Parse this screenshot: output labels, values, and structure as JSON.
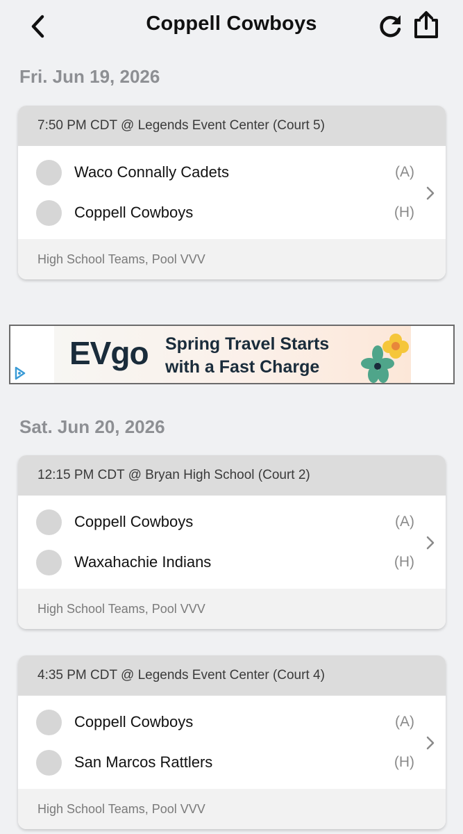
{
  "header": {
    "title": "Coppell Cowboys",
    "back_icon": "chevron-left-icon",
    "refresh_icon": "refresh-icon",
    "share_icon": "share-icon"
  },
  "days": [
    {
      "date": "Fri. Jun 19, 2026",
      "games": [
        {
          "time_location": "7:50 PM CDT @ Legends Event Center (Court 5)",
          "teams": [
            {
              "name": "Waco Connally Cadets",
              "side": "(A)"
            },
            {
              "name": "Coppell Cowboys",
              "side": "(H)"
            }
          ],
          "division": "High School Teams, Pool VVV"
        }
      ]
    },
    {
      "date": "Sat. Jun 20, 2026",
      "games": [
        {
          "time_location": "12:15 PM CDT @ Bryan High School (Court 2)",
          "teams": [
            {
              "name": "Coppell Cowboys",
              "side": "(A)"
            },
            {
              "name": "Waxahachie Indians",
              "side": "(H)"
            }
          ],
          "division": "High School Teams, Pool VVV"
        },
        {
          "time_location": "4:35 PM CDT @ Legends Event Center (Court 4)",
          "teams": [
            {
              "name": "Coppell Cowboys",
              "side": "(A)"
            },
            {
              "name": "San Marcos Rattlers",
              "side": "(H)"
            }
          ],
          "division": "High School Teams, Pool VVV"
        }
      ]
    }
  ],
  "ad": {
    "brand": "EVgo",
    "headline": "Spring Travel Starts with a Fast Charge",
    "choice_icon": "adchoices-icon"
  },
  "colors": {
    "background": "#f0f1f3",
    "card_header": "#dcdcdc",
    "date_heading": "#8d8f93",
    "ad_brand": "#1a2c3b"
  }
}
